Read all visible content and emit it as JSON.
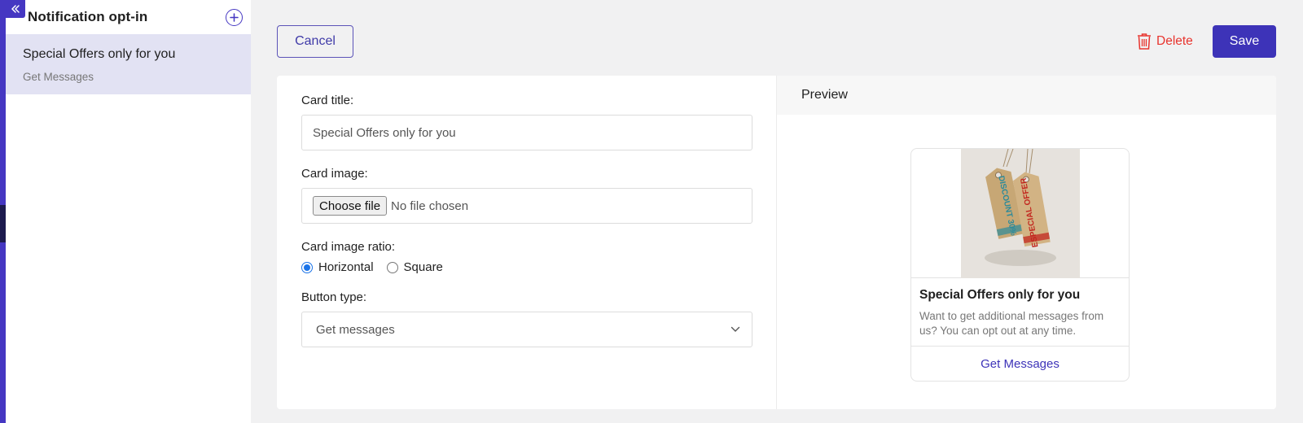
{
  "sidebar": {
    "title": "Notification opt-in",
    "items": [
      {
        "title": "Special Offers only for you",
        "subtitle": "Get Messages"
      }
    ]
  },
  "toolbar": {
    "cancel_label": "Cancel",
    "delete_label": "Delete",
    "save_label": "Save"
  },
  "form": {
    "card_title_label": "Card title:",
    "card_title_value": "Special Offers only for you",
    "card_image_label": "Card image:",
    "choose_file_label": "Choose file",
    "file_status": "No file chosen",
    "ratio_label": "Card image ratio:",
    "ratio_options": [
      "Horizontal",
      "Square"
    ],
    "ratio_selected": "Horizontal",
    "button_type_label": "Button type:",
    "button_type_value": "Get messages"
  },
  "preview": {
    "header": "Preview",
    "card_title": "Special Offers only for you",
    "card_description": "Want to get additional messages from us? You can opt out at any time.",
    "card_button": "Get Messages",
    "image_tag1_text": "DISCOUNT 30%",
    "image_tag2_text": "ESPECIAL OFFER"
  },
  "colors": {
    "accent": "#4537c2",
    "primary_button": "#3d33b8",
    "delete": "#e8342e",
    "sidebar_selected": "#e2e2f3",
    "radio_checked": "#1a73e8"
  },
  "icons": {
    "collapse": "double-chevron-left-icon",
    "add": "plus-circle-icon",
    "delete": "trash-icon",
    "select": "chevron-down-icon"
  }
}
